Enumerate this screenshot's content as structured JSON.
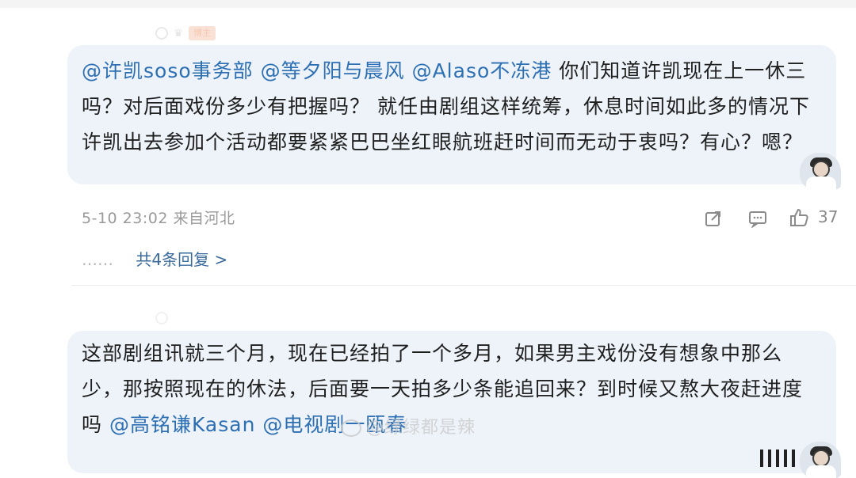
{
  "comment1": {
    "badge": "博主",
    "mentions": [
      "@许凯soso事务部",
      "@等夕阳与晨风",
      "@Alaso不冻港"
    ],
    "body": "你们知道许凯现在上一休三吗？对后面戏份多少有把握吗？ 就任由剧组这样统筹，休息时间如此多的情况下许凯出去参加个活动都要紧紧巴巴坐红眼航班赶时间而无动于衷吗？有心？嗯？",
    "time": "5-10 23:02",
    "location": "来自河北",
    "likes": "37",
    "replies_dots": "……",
    "replies_label": "共4条回复 >"
  },
  "comment2": {
    "body": "这部剧组讯就三个月，现在已经拍了一个多月，如果男主戏份没有想象中那么少，那按照现在的休法，后面要一天拍多少条能追回来？到时候又熬大夜赶进度吗",
    "mentions": [
      "@高铭谦Kasan",
      "@电视剧一瓯春"
    ]
  },
  "watermark": "@绿绿都是辣"
}
